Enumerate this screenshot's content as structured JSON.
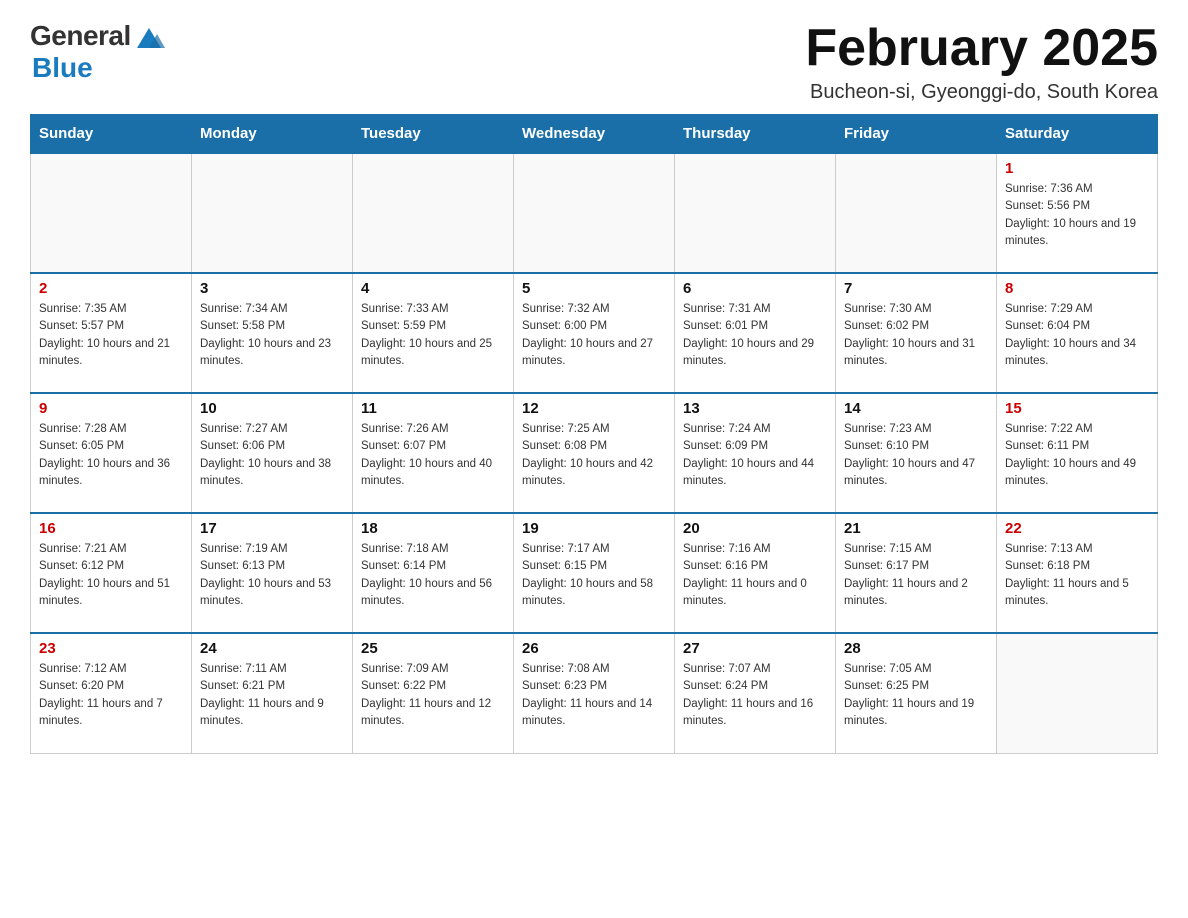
{
  "header": {
    "logo_general": "General",
    "logo_blue": "Blue",
    "month_title": "February 2025",
    "location": "Bucheon-si, Gyeonggi-do, South Korea"
  },
  "days_of_week": [
    "Sunday",
    "Monday",
    "Tuesday",
    "Wednesday",
    "Thursday",
    "Friday",
    "Saturday"
  ],
  "weeks": [
    [
      {
        "day": "",
        "info": ""
      },
      {
        "day": "",
        "info": ""
      },
      {
        "day": "",
        "info": ""
      },
      {
        "day": "",
        "info": ""
      },
      {
        "day": "",
        "info": ""
      },
      {
        "day": "",
        "info": ""
      },
      {
        "day": "1",
        "info": "Sunrise: 7:36 AM\nSunset: 5:56 PM\nDaylight: 10 hours and 19 minutes."
      }
    ],
    [
      {
        "day": "2",
        "info": "Sunrise: 7:35 AM\nSunset: 5:57 PM\nDaylight: 10 hours and 21 minutes."
      },
      {
        "day": "3",
        "info": "Sunrise: 7:34 AM\nSunset: 5:58 PM\nDaylight: 10 hours and 23 minutes."
      },
      {
        "day": "4",
        "info": "Sunrise: 7:33 AM\nSunset: 5:59 PM\nDaylight: 10 hours and 25 minutes."
      },
      {
        "day": "5",
        "info": "Sunrise: 7:32 AM\nSunset: 6:00 PM\nDaylight: 10 hours and 27 minutes."
      },
      {
        "day": "6",
        "info": "Sunrise: 7:31 AM\nSunset: 6:01 PM\nDaylight: 10 hours and 29 minutes."
      },
      {
        "day": "7",
        "info": "Sunrise: 7:30 AM\nSunset: 6:02 PM\nDaylight: 10 hours and 31 minutes."
      },
      {
        "day": "8",
        "info": "Sunrise: 7:29 AM\nSunset: 6:04 PM\nDaylight: 10 hours and 34 minutes."
      }
    ],
    [
      {
        "day": "9",
        "info": "Sunrise: 7:28 AM\nSunset: 6:05 PM\nDaylight: 10 hours and 36 minutes."
      },
      {
        "day": "10",
        "info": "Sunrise: 7:27 AM\nSunset: 6:06 PM\nDaylight: 10 hours and 38 minutes."
      },
      {
        "day": "11",
        "info": "Sunrise: 7:26 AM\nSunset: 6:07 PM\nDaylight: 10 hours and 40 minutes."
      },
      {
        "day": "12",
        "info": "Sunrise: 7:25 AM\nSunset: 6:08 PM\nDaylight: 10 hours and 42 minutes."
      },
      {
        "day": "13",
        "info": "Sunrise: 7:24 AM\nSunset: 6:09 PM\nDaylight: 10 hours and 44 minutes."
      },
      {
        "day": "14",
        "info": "Sunrise: 7:23 AM\nSunset: 6:10 PM\nDaylight: 10 hours and 47 minutes."
      },
      {
        "day": "15",
        "info": "Sunrise: 7:22 AM\nSunset: 6:11 PM\nDaylight: 10 hours and 49 minutes."
      }
    ],
    [
      {
        "day": "16",
        "info": "Sunrise: 7:21 AM\nSunset: 6:12 PM\nDaylight: 10 hours and 51 minutes."
      },
      {
        "day": "17",
        "info": "Sunrise: 7:19 AM\nSunset: 6:13 PM\nDaylight: 10 hours and 53 minutes."
      },
      {
        "day": "18",
        "info": "Sunrise: 7:18 AM\nSunset: 6:14 PM\nDaylight: 10 hours and 56 minutes."
      },
      {
        "day": "19",
        "info": "Sunrise: 7:17 AM\nSunset: 6:15 PM\nDaylight: 10 hours and 58 minutes."
      },
      {
        "day": "20",
        "info": "Sunrise: 7:16 AM\nSunset: 6:16 PM\nDaylight: 11 hours and 0 minutes."
      },
      {
        "day": "21",
        "info": "Sunrise: 7:15 AM\nSunset: 6:17 PM\nDaylight: 11 hours and 2 minutes."
      },
      {
        "day": "22",
        "info": "Sunrise: 7:13 AM\nSunset: 6:18 PM\nDaylight: 11 hours and 5 minutes."
      }
    ],
    [
      {
        "day": "23",
        "info": "Sunrise: 7:12 AM\nSunset: 6:20 PM\nDaylight: 11 hours and 7 minutes."
      },
      {
        "day": "24",
        "info": "Sunrise: 7:11 AM\nSunset: 6:21 PM\nDaylight: 11 hours and 9 minutes."
      },
      {
        "day": "25",
        "info": "Sunrise: 7:09 AM\nSunset: 6:22 PM\nDaylight: 11 hours and 12 minutes."
      },
      {
        "day": "26",
        "info": "Sunrise: 7:08 AM\nSunset: 6:23 PM\nDaylight: 11 hours and 14 minutes."
      },
      {
        "day": "27",
        "info": "Sunrise: 7:07 AM\nSunset: 6:24 PM\nDaylight: 11 hours and 16 minutes."
      },
      {
        "day": "28",
        "info": "Sunrise: 7:05 AM\nSunset: 6:25 PM\nDaylight: 11 hours and 19 minutes."
      },
      {
        "day": "",
        "info": ""
      }
    ]
  ]
}
